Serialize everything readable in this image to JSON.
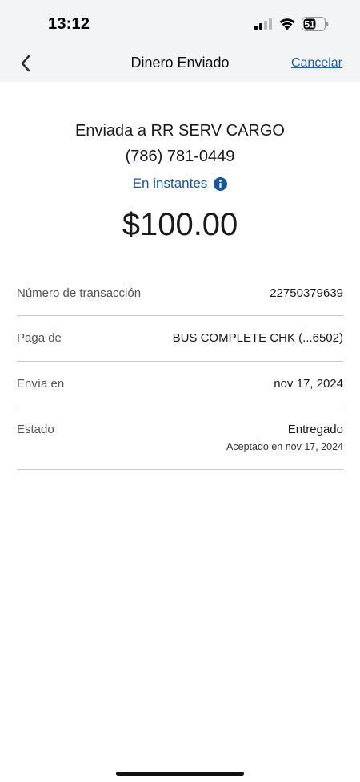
{
  "status_bar": {
    "time": "13:12",
    "battery_level": "51"
  },
  "nav": {
    "title": "Dinero Enviado",
    "cancel_label": "Cancelar"
  },
  "summary": {
    "sent_prefix": "Enviada a",
    "recipient": "RR SERV CARGO",
    "phone": "(786) 781-0449",
    "speed": "En instantes",
    "amount": "$100.00"
  },
  "details": [
    {
      "label": "Número de transacción",
      "value": "22750379639"
    },
    {
      "label": "Paga de",
      "value": "BUS COMPLETE CHK (...6502)"
    },
    {
      "label": "Envía en",
      "value": "nov 17, 2024"
    },
    {
      "label": "Estado",
      "value": "Entregado",
      "sub": "Aceptado en nov 17, 2024"
    }
  ],
  "colors": {
    "link_blue": "#1f5e9e",
    "accent_blue": "#16579b",
    "header_bg": "#f3f4f6",
    "divider": "#c9c9c9"
  },
  "icons": [
    "signal-icon",
    "wifi-icon",
    "battery-icon",
    "chevron-left-icon",
    "info-icon"
  ]
}
